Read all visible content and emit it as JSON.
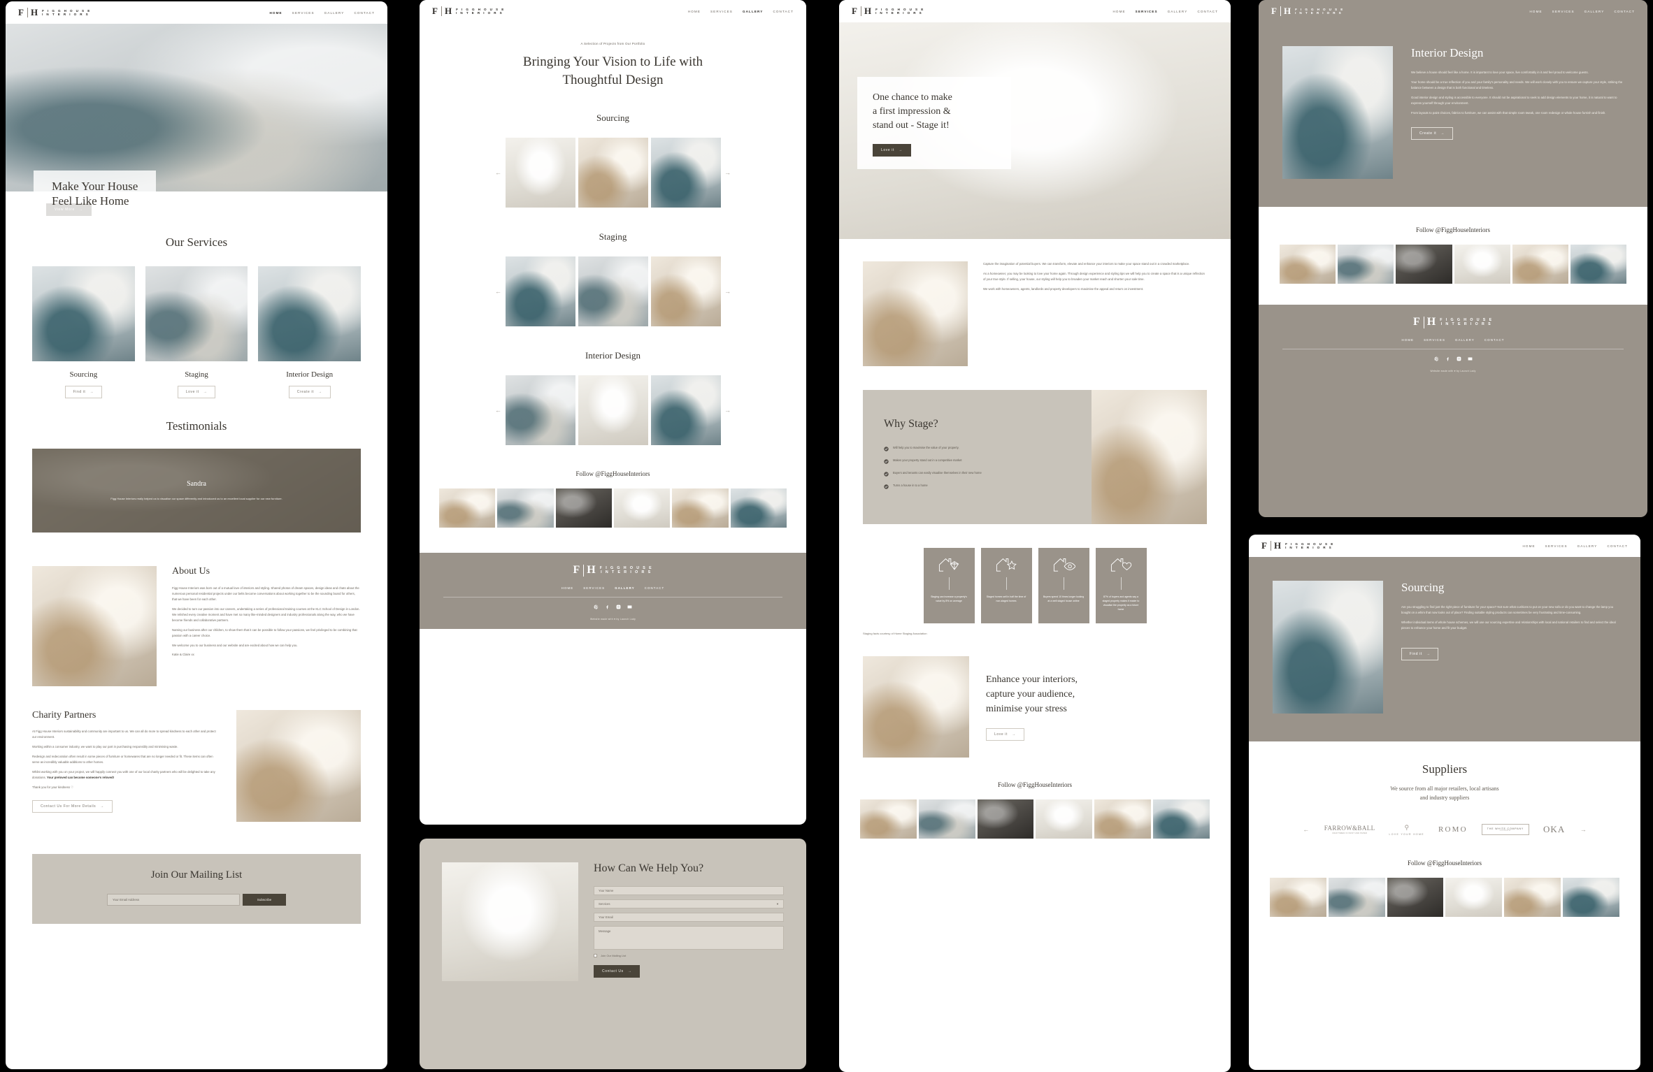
{
  "brand": {
    "mark_f": "F",
    "mark_h": "H",
    "word1": "F I G G   H O U S E",
    "word2": "I N T E R I O R S"
  },
  "nav": {
    "items": [
      "HOME",
      "SERVICES",
      "GALLERY",
      "CONTACT"
    ]
  },
  "colors": {
    "accent": "#4a4439",
    "warm_grey": "#9a938a",
    "text": "#3a3630",
    "muted": "#6e6860"
  },
  "home": {
    "nav_active": "HOME",
    "hero": {
      "line1": "Make Your House",
      "line2": "Feel Like Home",
      "cta": "View More"
    },
    "services": {
      "title": "Our Services",
      "items": [
        {
          "name": "Sourcing",
          "cta": "Find it"
        },
        {
          "name": "Staging",
          "cta": "Love it"
        },
        {
          "name": "Interior Design",
          "cta": "Create it"
        }
      ]
    },
    "testimonials": {
      "title": "Testimonials",
      "author": "Sandra",
      "quote": "Figg House Interiors really helped us to visualise our space differently and introduced us to an excellent local supplier for our new furniture."
    },
    "about": {
      "title": "About Us",
      "paragraphs": [
        "Figg House Interiors was born out of a mutual love of interiors and styling. Shared photos of dream spaces, design ideas and chats about the numerous personal residential projects under our belts become conversations about working together to be the sounding board for others, that we have been for each other.",
        "We decided to turn our passion into our careers, undertaking a series of professional training courses at the KLC School of Design in London. We relished every creative moment and have met so many like-minded designers and industry professionals along the way, who we have become friends and collaborative partners.",
        "Naming our business after our children, to show them that it can be possible to follow your passions, we feel privileged to be combining that passion with a career choice.",
        "We welcome you to our business and our website and are excited about how we can help you."
      ],
      "signature": "Katie & Claire xx"
    },
    "charity": {
      "title": "Charity Partners",
      "paragraphs": [
        "At Figg House Interiors sustainability and community are important to us.  We can all do more to spread kindness to each other and protect our environment.",
        "Working within a consumer industry, we want to play our part in purchasing responsibly and minimising waste.",
        "Redesign and redecoration often result in some pieces of furniture or homewares that are no longer needed or fit.  These items can often serve as incredibly valuable additions to other homes.",
        "Whilst working with you on your project, we will happily connect you with one of our local charity partners who will be delighted to take any donations."
      ],
      "highlight": "Your preloved can become someone's reloved!",
      "thanks": "Thank you for your kindness ♡",
      "cta": "Contact Us For More Details"
    },
    "mailing": {
      "title": "Join Our Mailing List",
      "placeholder": "Your Email Address",
      "cta": "Subscribe"
    }
  },
  "gallery": {
    "nav_active": "GALLERY",
    "eyebrow": "A Selection of Projects from Our Portfolio",
    "title_line1": "Bringing Your Vision to Life with",
    "title_line2": "Thoughtful Design",
    "sections": [
      "Sourcing",
      "Staging",
      "Interior Design"
    ],
    "insta_title": "Follow @FiggHouseInteriors"
  },
  "staging": {
    "nav_active": "SERVICES",
    "hero": {
      "line1": "One chance to make",
      "line2": "a first impression &",
      "line3": "stand out - Stage it!",
      "cta": "Love it"
    },
    "intro": [
      "Capture the imagination of potential buyers.  We can transform, elevate and enhance your interiors to make your space stand out in a crowded marketplace.",
      "As a homeowner, you may be looking to love your home again.  Through design experience and styling tips we will help you to create a space that is a unique reflection of your true style.  If selling, your house, our styling will help you to broaden your market reach and shorten your sale time.",
      "We work with homeowners, agents, landlords and property developers to maximise the appeal and return on investment."
    ],
    "why": {
      "title": "Why Stage?",
      "points": [
        "Will help you to maximise the value of your property.",
        "Makes your property stand out in a competitive market",
        "Buyers and tenants can easily visualise themselves in their new home",
        "Turns a house in to a home"
      ]
    },
    "facts": [
      {
        "icon": "diamond-icon",
        "text": "Staging can increase a property's value by 8% on average"
      },
      {
        "icon": "star-icon",
        "text": "Staged homes sell in half the time of non-staged homes"
      },
      {
        "icon": "eye-icon",
        "text": "Buyers spend 10 times longer looking at a well staged house online"
      },
      {
        "icon": "heart-icon",
        "text": "87% of buyers and agents say a staged property makes it easier to visualise the property as a future home"
      }
    ],
    "facts_credit": "Staging facts courtesy of Home Staging Association",
    "enhance": {
      "line1": "Enhance your interiors,",
      "line2": "capture your audience,",
      "line3": "minimise your stress",
      "cta": "Love it"
    },
    "insta_title": "Follow @FiggHouseInteriors"
  },
  "interior_design": {
    "nav_active": "SERVICES",
    "title": "Interior Design",
    "paragraphs": [
      "We believe a house should feel like a home.  It is important to love your space, live comfortably in it and feel proud to welcome guests.",
      "Your home should be a true reflection of you and your family's personality and needs. We will work closely with you to ensure we capture your style, striking the balance between a design that is both functional and timeless.",
      "Good interior design and styling is accessible to everyone.  It should not be aspirational to seek to add design elements to your home, it is natural to want to express yourself through your environment.",
      "From layouts to paint choices, fabrics to furniture, we can assist with that simple room tweak, one room redesign or whole house furnish and finish."
    ],
    "cta": "Create it",
    "insta_title": "Follow @FiggHouseInteriors",
    "footer_credit": "Website made with ♥ by Launch Lady"
  },
  "sourcing": {
    "nav_active": "SERVICES",
    "title": "Sourcing",
    "paragraphs": [
      "Are you struggling to find just the right piece of furniture for your space?  Not sure what cushions to put on your new sofa or do you want to change the lamp you bought on a whim that now looks out of place?  Finding suitable styling products can sometimes be very frustrating and time-consuming.",
      "Whether individual items of whole house schemes, we will use our sourcing expertise and relationships with local and national retailers to find and select the ideal pieces to enhance your home and fit your budget."
    ],
    "cta": "Find it",
    "suppliers": {
      "title": "Suppliers",
      "subtitle_line1": "We source from all major retailers, local artisans",
      "subtitle_line2": "and industry suppliers",
      "logos": [
        "FARROW&BALL",
        "LOVE YOUR HOME",
        "ROMO",
        "THE WHITE COMPANY",
        "OKA"
      ],
      "farrow_sub": "CRAFTSMEN IN PAINT AND PAPER",
      "white_sub": "LONDON"
    },
    "insta_title": "Follow @FiggHouseInteriors"
  },
  "contact": {
    "title": "How Can We Help You?",
    "fields": {
      "name": "Your Name",
      "service": "Services",
      "email": "Your Email",
      "message": "Message"
    },
    "checkbox": "Join Our Mailing List",
    "cta": "Contact Us"
  }
}
